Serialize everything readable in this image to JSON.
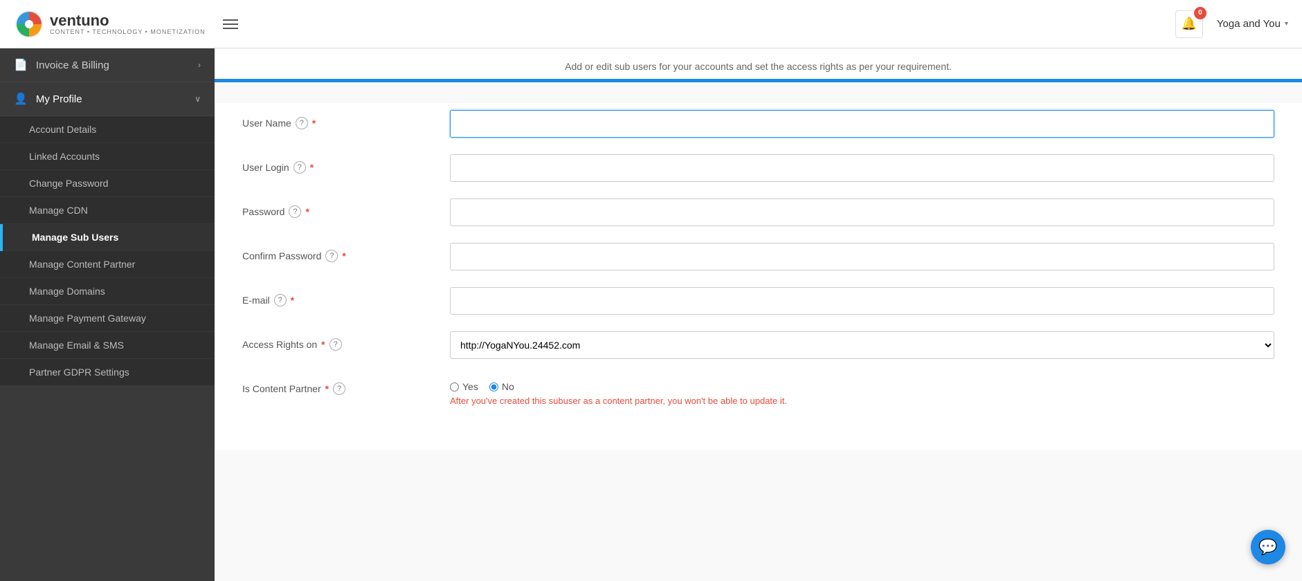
{
  "header": {
    "logo_name": "ventuno",
    "logo_tagline": "CONTENT • TECHNOLOGY • MONETIZATION",
    "notification_count": "0",
    "user_name": "Yoga and You",
    "chevron": "▾"
  },
  "sidebar": {
    "invoice_billing_label": "Invoice & Billing",
    "my_profile_label": "My Profile",
    "sub_items": [
      {
        "id": "account-details",
        "label": "Account Details"
      },
      {
        "id": "linked-accounts",
        "label": "Linked Accounts"
      },
      {
        "id": "change-password",
        "label": "Change Password"
      },
      {
        "id": "manage-cdn",
        "label": "Manage CDN"
      },
      {
        "id": "manage-sub-users",
        "label": "Manage Sub Users",
        "active": true
      },
      {
        "id": "manage-content-partner",
        "label": "Manage Content Partner"
      },
      {
        "id": "manage-domains",
        "label": "Manage Domains"
      },
      {
        "id": "manage-payment-gateway",
        "label": "Manage Payment Gateway"
      },
      {
        "id": "manage-email-sms",
        "label": "Manage Email & SMS"
      },
      {
        "id": "partner-gdpr",
        "label": "Partner GDPR Settings"
      }
    ]
  },
  "main": {
    "description": "Add or edit sub users for your accounts and set the access rights as per your requirement.",
    "form": {
      "username_label": "User Name",
      "username_placeholder": "",
      "userlogin_label": "User Login",
      "password_label": "Password",
      "confirm_password_label": "Confirm Password",
      "email_label": "E-mail",
      "access_rights_label": "Access Rights on",
      "access_rights_option": "http://YogaNYou.24452.com",
      "is_content_partner_label": "Is Content Partner",
      "yes_label": "Yes",
      "no_label": "No",
      "content_partner_note": "After you've created this subuser as a content partner, you won't be able to update it.",
      "required_marker": "*"
    }
  }
}
